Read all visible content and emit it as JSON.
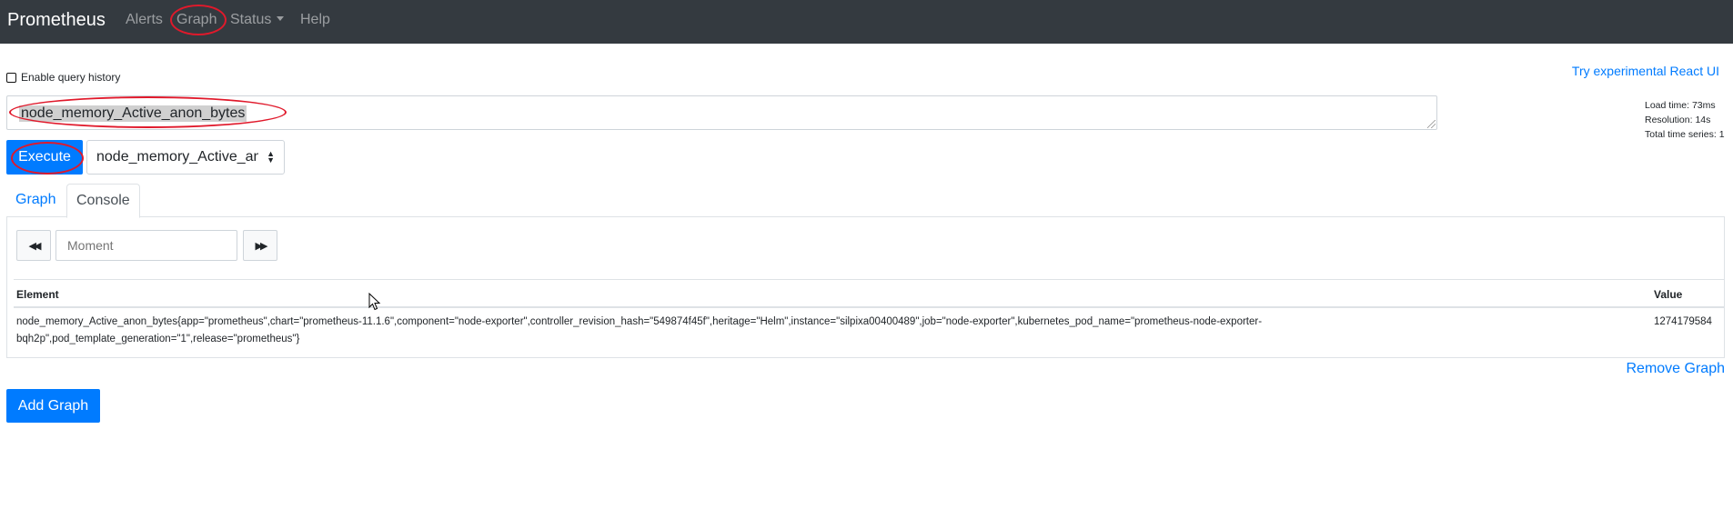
{
  "navbar": {
    "brand": "Prometheus",
    "links": {
      "alerts": "Alerts",
      "graph": "Graph",
      "status": "Status",
      "help": "Help"
    }
  },
  "query_history": {
    "label": "Enable query history",
    "checked": false
  },
  "react_link": "Try experimental React UI",
  "expression": "node_memory_Active_anon_bytes",
  "stats": {
    "load_time": "Load time: 73ms",
    "resolution": "Resolution: 14s",
    "total_series": "Total time series: 1"
  },
  "execute_label": "Execute",
  "metric_select": {
    "selected": "node_memory_Active_anon_bytes"
  },
  "tabs": {
    "graph": "Graph",
    "console": "Console"
  },
  "console": {
    "moment_placeholder": "Moment",
    "headers": {
      "element": "Element",
      "value": "Value"
    },
    "rows": [
      {
        "element": "node_memory_Active_anon_bytes{app=\"prometheus\",chart=\"prometheus-11.1.6\",component=\"node-exporter\",controller_revision_hash=\"549874f45f\",heritage=\"Helm\",instance=\"silpixa00400489\",job=\"node-exporter\",kubernetes_pod_name=\"prometheus-node-exporter-bqh2p\",pod_template_generation=\"1\",release=\"prometheus\"}",
        "value": "1274179584"
      }
    ]
  },
  "remove_graph_label": "Remove Graph",
  "add_graph_label": "Add Graph",
  "colors": {
    "navbar": "#343a40",
    "primary": "#007bff",
    "annotation": "#e0192b"
  }
}
